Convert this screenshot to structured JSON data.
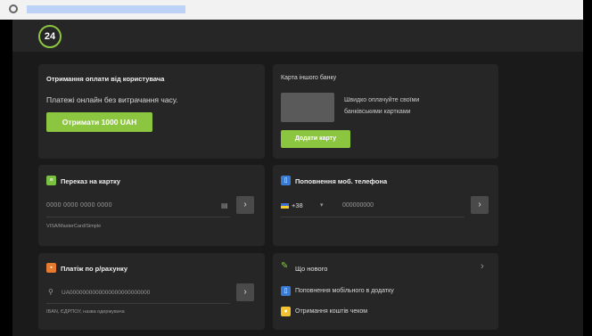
{
  "browser": {
    "url": ""
  },
  "header": {
    "logo_text": "24"
  },
  "colors": {
    "accent": "#8cc640",
    "card": "#262626",
    "background": "#1a1a1a"
  },
  "receive_payment": {
    "title": "Отримання оплати від користувача",
    "subtitle": "Платежі онлайн без витрачання часу.",
    "button": "Отримати 1000 UAH"
  },
  "other_bank_card": {
    "title": "Карта іншого банку",
    "description_line1": "Швидко оплачуйте своїми",
    "description_line2": "банківськими картками",
    "button": "Додати карту"
  },
  "card_transfer": {
    "icon": "card-icon",
    "title": "Переказ на картку",
    "placeholder": "0000 0000 0000 0000",
    "note": "VISA/MasterCard/Simple",
    "arrow": "›"
  },
  "phone_topup": {
    "icon": "phone-icon",
    "title": "Поповнення моб. телефона",
    "country_code": "+38",
    "dropdown": "▾",
    "placeholder": "000000000",
    "arrow": "›"
  },
  "account_payment": {
    "icon": "document-icon",
    "title": "Платіж по р/рахунку",
    "placeholder": "UA0000000000000000000000000",
    "note": "IBAN, ЄДРПОУ, назва одержувача",
    "arrow": "›"
  },
  "whats_new": {
    "title": "Що нового",
    "chevron": "›",
    "items": [
      {
        "icon": "phone-icon",
        "label": "Поповнення мобільного в додатку"
      },
      {
        "icon": "coins-icon",
        "label": "Отримання коштів чеком"
      }
    ]
  }
}
